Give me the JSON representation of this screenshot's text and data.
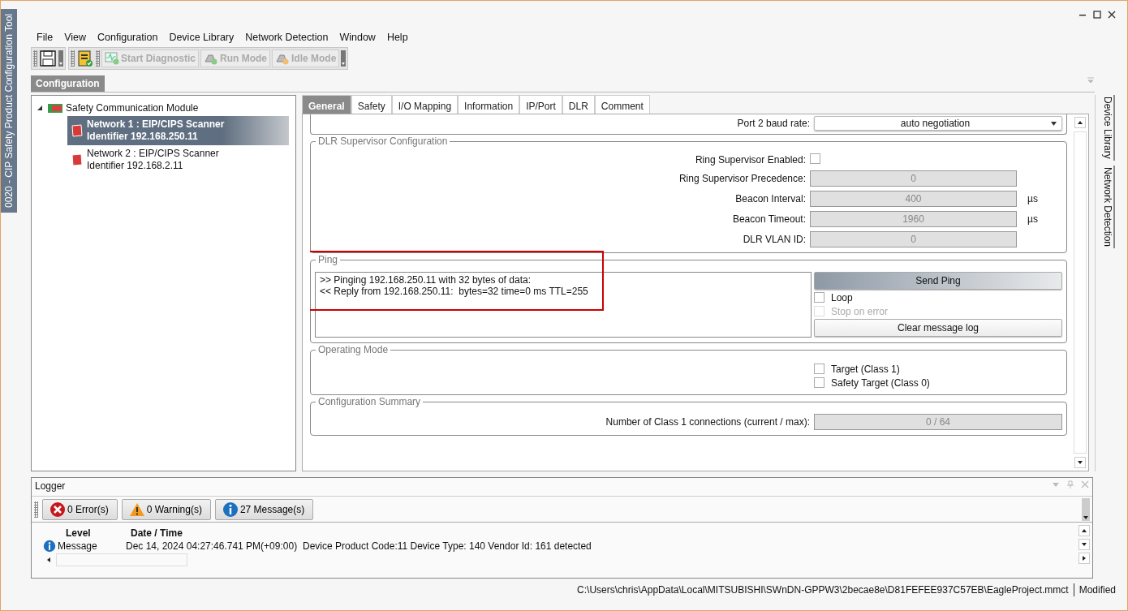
{
  "window": {
    "side_title": "0020 - CIP Safety Product Configuration Tool"
  },
  "menu": [
    "File",
    "View",
    "Configuration",
    "Device Library",
    "Network Detection",
    "Window",
    "Help"
  ],
  "toolbar": [
    {
      "kind": "diagnostic",
      "label": "Start Diagnostic",
      "disabled": true
    },
    {
      "kind": "run",
      "label": "Run Mode",
      "disabled": true
    },
    {
      "kind": "idle",
      "label": "Idle Mode",
      "disabled": true
    }
  ],
  "document_tab": {
    "label": "Configuration"
  },
  "tree": [
    {
      "label": "Safety Communication Module",
      "expanded": true,
      "children": [
        {
          "label": "Network 1 : EIP/CIPS Scanner",
          "sublabel": "Identifier 192.168.250.11",
          "selected": true
        },
        {
          "label": "Network 2 : EIP/CIPS Scanner",
          "sublabel": "Identifier 192.168.2.11",
          "selected": false
        }
      ]
    }
  ],
  "tabs": [
    {
      "label": "General",
      "selected": true
    },
    {
      "label": "Safety",
      "selected": false
    },
    {
      "label": "I/O Mapping",
      "selected": false
    },
    {
      "label": "Information",
      "selected": false
    },
    {
      "label": "IP/Port",
      "selected": false
    },
    {
      "label": "DLR",
      "selected": false
    },
    {
      "label": "Comment",
      "selected": false
    }
  ],
  "port_row": {
    "label": "Port 2 baud rate:",
    "value": "auto negotiation"
  },
  "dlr": {
    "title": "DLR Supervisor Configuration",
    "fields": [
      {
        "kind": "checkbox",
        "label": "Ring Supervisor Enabled:",
        "checked": false
      },
      {
        "kind": "input",
        "label": "Ring Supervisor Precedence:",
        "value": "0"
      },
      {
        "kind": "input",
        "label": "Beacon Interval:",
        "value": "400",
        "unit": "µs"
      },
      {
        "kind": "input",
        "label": "Beacon Timeout:",
        "value": "1960",
        "unit": "µs"
      },
      {
        "kind": "input",
        "label": "DLR VLAN ID:",
        "value": "0"
      }
    ]
  },
  "ping": {
    "title": "Ping",
    "highlighted": true,
    "log": [
      ">> Pinging 192.168.250.11 with 32 bytes of data:",
      "<< Reply from 192.168.250.11:  bytes=32 time=0 ms TTL=255"
    ],
    "send_button": "Send Ping",
    "options": [
      {
        "label": "Loop",
        "checked": false,
        "disabled": false
      },
      {
        "label": "Stop on error",
        "checked": false,
        "disabled": true
      }
    ],
    "clear_button": "Clear message log"
  },
  "operating_mode": {
    "title": "Operating Mode",
    "options": [
      {
        "label": "Target (Class 1)",
        "checked": false
      },
      {
        "label": "Safety Target (Class 0)",
        "checked": false
      }
    ]
  },
  "summary": {
    "title": "Configuration Summary",
    "label": "Number of Class 1 connections (current / max):",
    "value": "0 / 64"
  },
  "side_tabs": [
    "Device Library",
    "Network Detection"
  ],
  "logger": {
    "title": "Logger",
    "filters": [
      {
        "kind": "error",
        "label": "0 Error(s)"
      },
      {
        "kind": "warning",
        "label": "0 Warning(s)"
      },
      {
        "kind": "info",
        "label": "27 Message(s)"
      }
    ],
    "columns": [
      "Level",
      "Date / Time"
    ],
    "rows": [
      {
        "kind": "info",
        "level": "Message",
        "time": "Dec 14, 2024 04:27:46.741 PM(+09:00)",
        "message": "Device Product Code:11 Device Type: 140 Vendor Id: 161 detected"
      }
    ]
  },
  "status_bar": {
    "path": "C:\\Users\\chris\\AppData\\Local\\MITSUBISHI\\SWnDN-GPPW3\\2becae8e\\D81FEFEE937C57EB\\EagleProject.mmct",
    "state": "Modified"
  }
}
